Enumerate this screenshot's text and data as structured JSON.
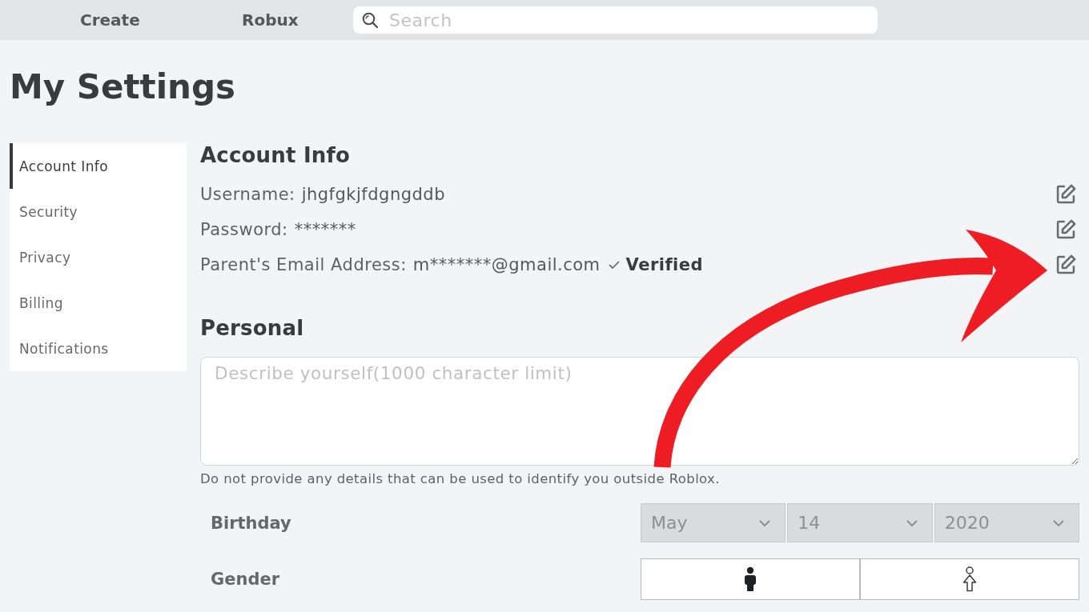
{
  "topbar": {
    "nav": [
      {
        "label": "Create"
      },
      {
        "label": "Robux"
      }
    ],
    "search": {
      "placeholder": "Search"
    }
  },
  "page": {
    "title": "My Settings"
  },
  "sidebar": {
    "items": [
      {
        "label": "Account Info",
        "selected": true
      },
      {
        "label": "Security",
        "selected": false
      },
      {
        "label": "Privacy",
        "selected": false
      },
      {
        "label": "Billing",
        "selected": false
      },
      {
        "label": "Notifications",
        "selected": false
      }
    ]
  },
  "account_info": {
    "heading": "Account Info",
    "rows": [
      {
        "label": "Username:",
        "value": "jhgfgkjfdgngddb"
      },
      {
        "label": "Password:",
        "value": "*******"
      },
      {
        "label": "Parent's Email Address:",
        "value": "m*******@gmail.com",
        "status": "Verified"
      }
    ]
  },
  "personal": {
    "heading": "Personal",
    "about": {
      "placeholder": "Describe yourself(1000 character limit)"
    },
    "hint": "Do not provide any details that can be used to identify you outside Roblox.",
    "birthday": {
      "label": "Birthday",
      "fields": [
        {
          "value": "May",
          "disabled": true
        },
        {
          "value": "14",
          "disabled": true
        },
        {
          "value": "2020",
          "disabled": true
        }
      ]
    },
    "gender": {
      "label": "Gender",
      "options": [
        {
          "kind": "male",
          "selected": true
        },
        {
          "kind": "female",
          "selected": false
        }
      ]
    }
  }
}
